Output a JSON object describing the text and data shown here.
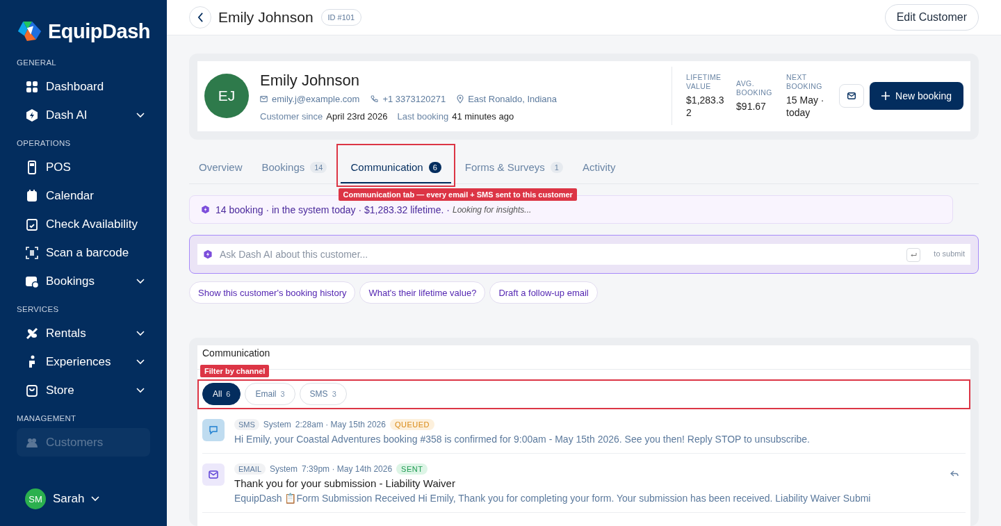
{
  "sidebar": {
    "brand": "EquipDash",
    "sections": [
      {
        "title": "GENERAL",
        "items": [
          {
            "label": "Dashboard",
            "expandable": false,
            "selected": false
          },
          {
            "label": "Dash AI",
            "expandable": true,
            "selected": false
          }
        ]
      },
      {
        "title": "OPERATIONS",
        "items": [
          {
            "label": "POS",
            "expandable": false,
            "selected": false
          },
          {
            "label": "Calendar",
            "expandable": false,
            "selected": false
          },
          {
            "label": "Check Availability",
            "expandable": false,
            "selected": false
          },
          {
            "label": "Scan a barcode",
            "expandable": false,
            "selected": false
          },
          {
            "label": "Bookings",
            "expandable": true,
            "selected": false
          }
        ]
      },
      {
        "title": "SERVICES",
        "items": [
          {
            "label": "Rentals",
            "expandable": true,
            "selected": false
          },
          {
            "label": "Experiences",
            "expandable": true,
            "selected": false
          },
          {
            "label": "Store",
            "expandable": true,
            "selected": false
          }
        ]
      },
      {
        "title": "MANAGEMENT",
        "items": [
          {
            "label": "Customers",
            "expandable": false,
            "selected": true
          }
        ]
      }
    ],
    "user": {
      "initials": "SM",
      "name": "Sarah"
    }
  },
  "header": {
    "title": "Emily Johnson",
    "id_badge": "ID #101",
    "edit_button": "Edit Customer"
  },
  "profile": {
    "initials": "EJ",
    "name": "Emily Johnson",
    "email": "emily.j@example.com",
    "phone": "+1 3373120271",
    "location": "East Ronaldo, Indiana",
    "since_label": "Customer since",
    "since_value": "April 23rd 2026",
    "last_label": "Last booking",
    "last_value": "41 minutes ago",
    "stats": [
      {
        "label": "LIFETIME VALUE",
        "value": "$1,283.32"
      },
      {
        "label": "AVG. BOOKING",
        "value": "$91.67"
      },
      {
        "label": "NEXT BOOKING",
        "value": "15 May · today"
      }
    ],
    "new_booking_button": "New booking"
  },
  "tabs": [
    {
      "label": "Overview",
      "selected": false
    },
    {
      "label": "Bookings",
      "count": "14",
      "selected": false
    },
    {
      "label": "Communication",
      "count": "6",
      "selected": true,
      "annotation": "Communication tab — every email + SMS sent to this customer"
    },
    {
      "label": "Forms & Surveys",
      "count": "1",
      "selected": false
    },
    {
      "label": "Activity",
      "selected": false
    }
  ],
  "insight": {
    "text": "14 booking · in the system today · $1,283.32 lifetime. ·",
    "status": "Looking for insights..."
  },
  "ask": {
    "placeholder": "Ask Dash AI about this customer...",
    "hint": "to submit"
  },
  "suggestions": [
    "Show this customer's booking history",
    "What's their lifetime value?",
    "Draft a follow-up email"
  ],
  "communication": {
    "title": "Communication",
    "filter_annotation": "Filter by channel",
    "filters": [
      {
        "label": "All",
        "count": "6",
        "selected": true
      },
      {
        "label": "Email",
        "count": "3",
        "selected": false
      },
      {
        "label": "SMS",
        "count": "3",
        "selected": false
      }
    ],
    "messages": [
      {
        "kind": "sms",
        "channel": "SMS",
        "author": "System",
        "time": "2:28am · May 15th 2026",
        "status": "QUEUED",
        "body": "Hi Emily, your Coastal Adventures booking #358 is confirmed for 9:00am - May 15th 2026. See you then! Reply STOP to unsubscribe."
      },
      {
        "kind": "email",
        "channel": "EMAIL",
        "author": "System",
        "time": "7:39pm · May 14th 2026",
        "status": "SENT",
        "subject": "Thank you for your submission - Liability Waiver",
        "body": "EquipDash 📋Form Submission Received Hi Emily, Thank you for completing your form. Your submission has been received. Liability Waiver Submi"
      }
    ]
  }
}
